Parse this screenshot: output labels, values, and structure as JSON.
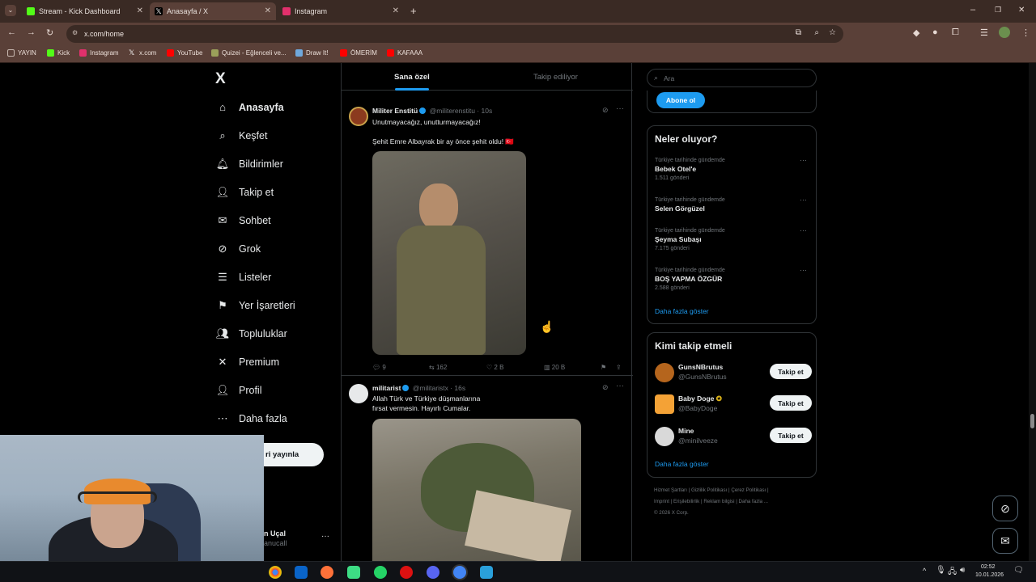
{
  "browser": {
    "tabs": [
      {
        "label": "Stream - Kick Dashboard",
        "color": "#53fc18"
      },
      {
        "label": "Anasayfa / X",
        "color": "#ffffff"
      },
      {
        "label": "Instagram",
        "color": "#e1306c"
      }
    ],
    "new_tab": "+",
    "window_controls": {
      "minimize": "–",
      "restore": "❐",
      "close": "✕"
    },
    "address": "x.com/home",
    "bookmarks": [
      {
        "label": "YAYIN",
        "color": "#c8b8b0"
      },
      {
        "label": "Kick",
        "color": "#53fc18"
      },
      {
        "label": "Instagram",
        "color": "#e1306c"
      },
      {
        "label": "x.com",
        "color": "#ffffff"
      },
      {
        "label": "YouTube",
        "color": "#ff0000"
      },
      {
        "label": "Quizei - Eğlenceli ve...",
        "color": "#9aa05a"
      },
      {
        "label": "Draw It!",
        "color": "#6fa8dc"
      },
      {
        "label": "ÖMERİM",
        "color": "#ff0000"
      },
      {
        "label": "KAFAAA",
        "color": "#ff0000"
      }
    ]
  },
  "sidebar": {
    "logo": "X",
    "items": [
      {
        "label": "Anasayfa",
        "icon": "home-icon",
        "glyph": "⌂"
      },
      {
        "label": "Keşfet",
        "icon": "search-icon",
        "glyph": "⌕"
      },
      {
        "label": "Bildirimler",
        "icon": "bell-icon",
        "glyph": "🔔︎"
      },
      {
        "label": "Takip et",
        "icon": "follow-icon",
        "glyph": "👤︎"
      },
      {
        "label": "Sohbet",
        "icon": "mail-icon",
        "glyph": "✉"
      },
      {
        "label": "Grok",
        "icon": "grok-icon",
        "glyph": "⊘"
      },
      {
        "label": "Listeler",
        "icon": "list-icon",
        "glyph": "☰"
      },
      {
        "label": "Yer İşaretleri",
        "icon": "bookmark-icon",
        "glyph": "⚑"
      },
      {
        "label": "Topluluklar",
        "icon": "communities-icon",
        "glyph": "👥︎"
      },
      {
        "label": "Premium",
        "icon": "x-premium-icon",
        "glyph": "✕"
      },
      {
        "label": "Profil",
        "icon": "profile-icon",
        "glyph": "👤︎"
      },
      {
        "label": "Daha fazla",
        "icon": "more-icon",
        "glyph": "⋯"
      }
    ],
    "post_button": "ri yayınla",
    "account_name": "n Uçal",
    "account_handle": "anucall",
    "account_more": "···"
  },
  "feed": {
    "tabs": {
      "for_you": "Sana özel",
      "following": "Takip ediliyor"
    },
    "posts": [
      {
        "name": "Militer Enstitü",
        "handle": "@militerenstitu",
        "time": "· 10s",
        "line1": "Unutmayacağız, unutturmayacağız!",
        "line2": "Şehit Emre Albayrak bir ay önce şehit oldu! 🇹🇷",
        "replies": "9",
        "reposts": "162",
        "likes": "2 B",
        "views": "20 B"
      },
      {
        "name": "militarist",
        "handle": "@militaristx",
        "time": "· 16s",
        "line1": "Allah Türk ve Türkiye düşmanlarına",
        "line2": "fırsat vermesin. Hayırlı Cumalar."
      }
    ]
  },
  "right": {
    "search_placeholder": "Ara",
    "subscribe": "Abone ol",
    "trends_title": "Neler oluyor?",
    "trends": [
      {
        "context": "Türkiye tarihinde gündemde",
        "name": "Bebek Otel'e",
        "count": "1.511 gönderi"
      },
      {
        "context": "Türkiye tarihinde gündemde",
        "name": "Selen Görgüzel",
        "count": ""
      },
      {
        "context": "Türkiye tarihinde gündemde",
        "name": "Şeyma Subaşı",
        "count": "7.175 gönderi"
      },
      {
        "context": "Türkiye tarihinde gündemde",
        "name": "BOŞ YAPMA ÖZGÜR",
        "count": "2.588 gönderi"
      }
    ],
    "show_more": "Daha fazla göster",
    "who_title": "Kimi takip etmeli",
    "who": [
      {
        "name": "GunsNBrutus",
        "handle": "@GunsNBrutus",
        "button": "Takip et",
        "color": "#b5651d"
      },
      {
        "name": "Baby Doge",
        "handle": "@BabyDoge",
        "button": "Takip et",
        "color": "#f4a236"
      },
      {
        "name": "Mine",
        "handle": "@minilveeze",
        "button": "Takip et",
        "color": "#d9d9d9"
      }
    ],
    "who_more": "Daha fazla göster",
    "footer_line1": "Hizmet Şartları | Gizlilik Politikası | Çerez Politikası |",
    "footer_line2": "Imprint | Erişilebilirlik | Reklam bilgisi | Daha fazla ...",
    "footer_line3": "© 2026 X Corp."
  },
  "taskbar": {
    "time": "02:52",
    "date": "10.01.2026"
  }
}
